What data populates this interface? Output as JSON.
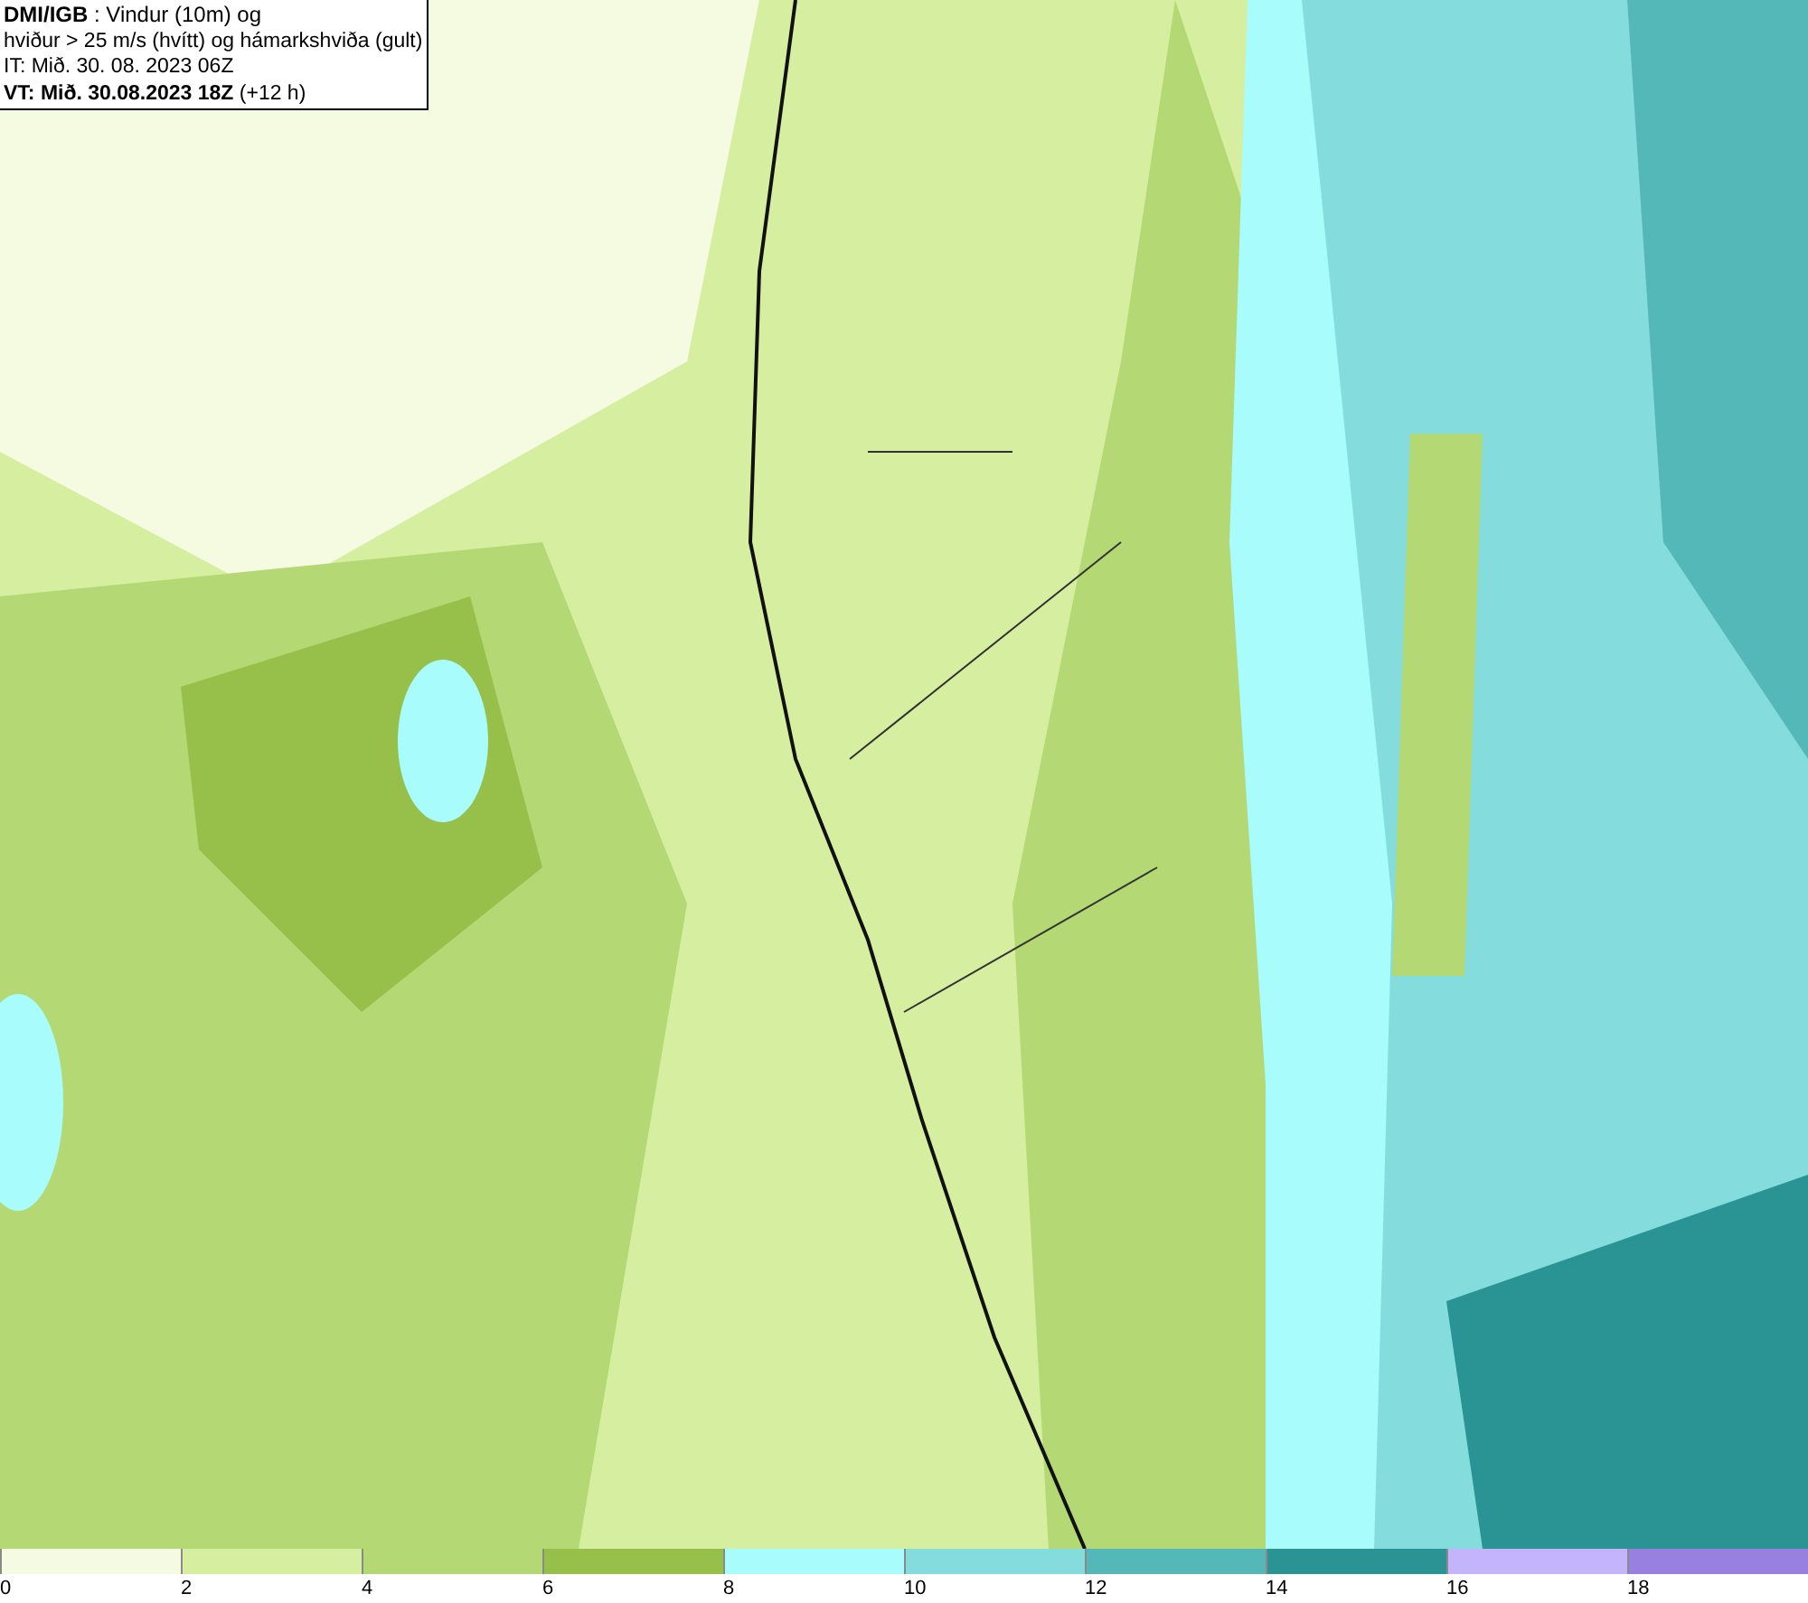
{
  "header": {
    "lines": [
      "**DMI/IGB** : Vindur (10m) og",
      "hviður > 25 m/s (hvítt) og hámarkshviða (gult)",
      "IT: Mið. 30. 08. 2023 06Z",
      "**VT: Mið. 30.08.2023 18Z** (+12 h)"
    ]
  },
  "legend": [
    {
      "label": "0",
      "color": "#f4fbe0"
    },
    {
      "label": "2",
      "color": "#d6eea0"
    },
    {
      "label": "4",
      "color": "#b3d874"
    },
    {
      "label": "6",
      "color": "#97c04a"
    },
    {
      "label": "8",
      "color": "#a8fcfc"
    },
    {
      "label": "10",
      "color": "#85dcdc"
    },
    {
      "label": "12",
      "color": "#55b8b8"
    },
    {
      "label": "14",
      "color": "#2a9494"
    },
    {
      "label": "16",
      "color": "#c4b4fc"
    },
    {
      "label": "18",
      "color": "#9880e0"
    }
  ]
}
